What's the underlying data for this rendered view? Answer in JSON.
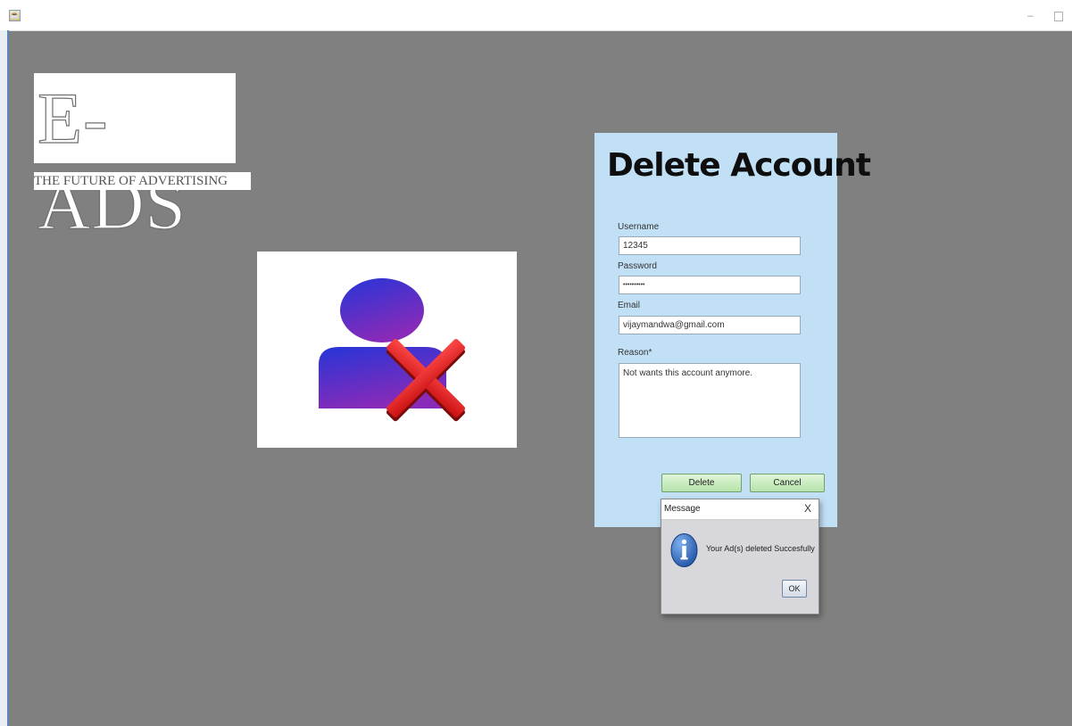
{
  "window": {
    "icon": "java-cup-icon",
    "minimize": "–",
    "maximize": "□"
  },
  "logo": {
    "text": "E-ADS",
    "tagline": "THE FUTURE OF ADVERTISING"
  },
  "form": {
    "title": "Delete Account",
    "username_label": "Username",
    "username_value": "12345",
    "password_label": "Password",
    "password_value": "••••••••••",
    "email_label": "Email",
    "email_value": "vijaymandwa@gmail.com",
    "reason_label": "Reason*",
    "reason_value": "Not wants this account anymore.",
    "delete_label": "Delete",
    "cancel_label": "Cancel"
  },
  "dialog": {
    "title": "Message",
    "close": "X",
    "icon": "info-icon",
    "message": "Your Ad(s) deleted Succesfully",
    "ok_label": "OK"
  },
  "colors": {
    "background": "#808080",
    "panel": "#c2e0f5",
    "button": "#b6e3aa",
    "user_icon_top": "#2535d8",
    "user_icon_bottom": "#8a2ab8",
    "cross": "#e11d1d"
  }
}
